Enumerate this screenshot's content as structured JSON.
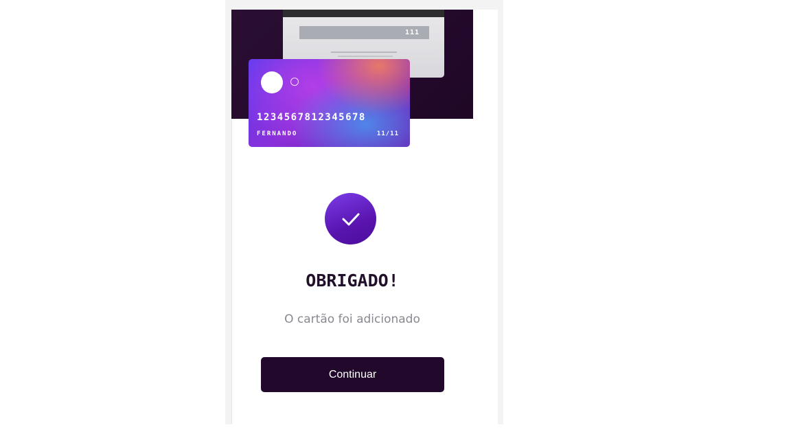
{
  "card_back": {
    "cvv": "111"
  },
  "card_front": {
    "number": "1234567812345678",
    "holder": "FERNANDO",
    "expiry": "11/11"
  },
  "success": {
    "icon": "checkmark-icon",
    "title": "OBRIGADO!",
    "message": "O cartão foi adicionado"
  },
  "actions": {
    "continue_label": "Continuar"
  },
  "colors": {
    "brand_dark": "#22092b",
    "accent_purple": "#5a14b0",
    "muted_text": "#8a8790"
  }
}
